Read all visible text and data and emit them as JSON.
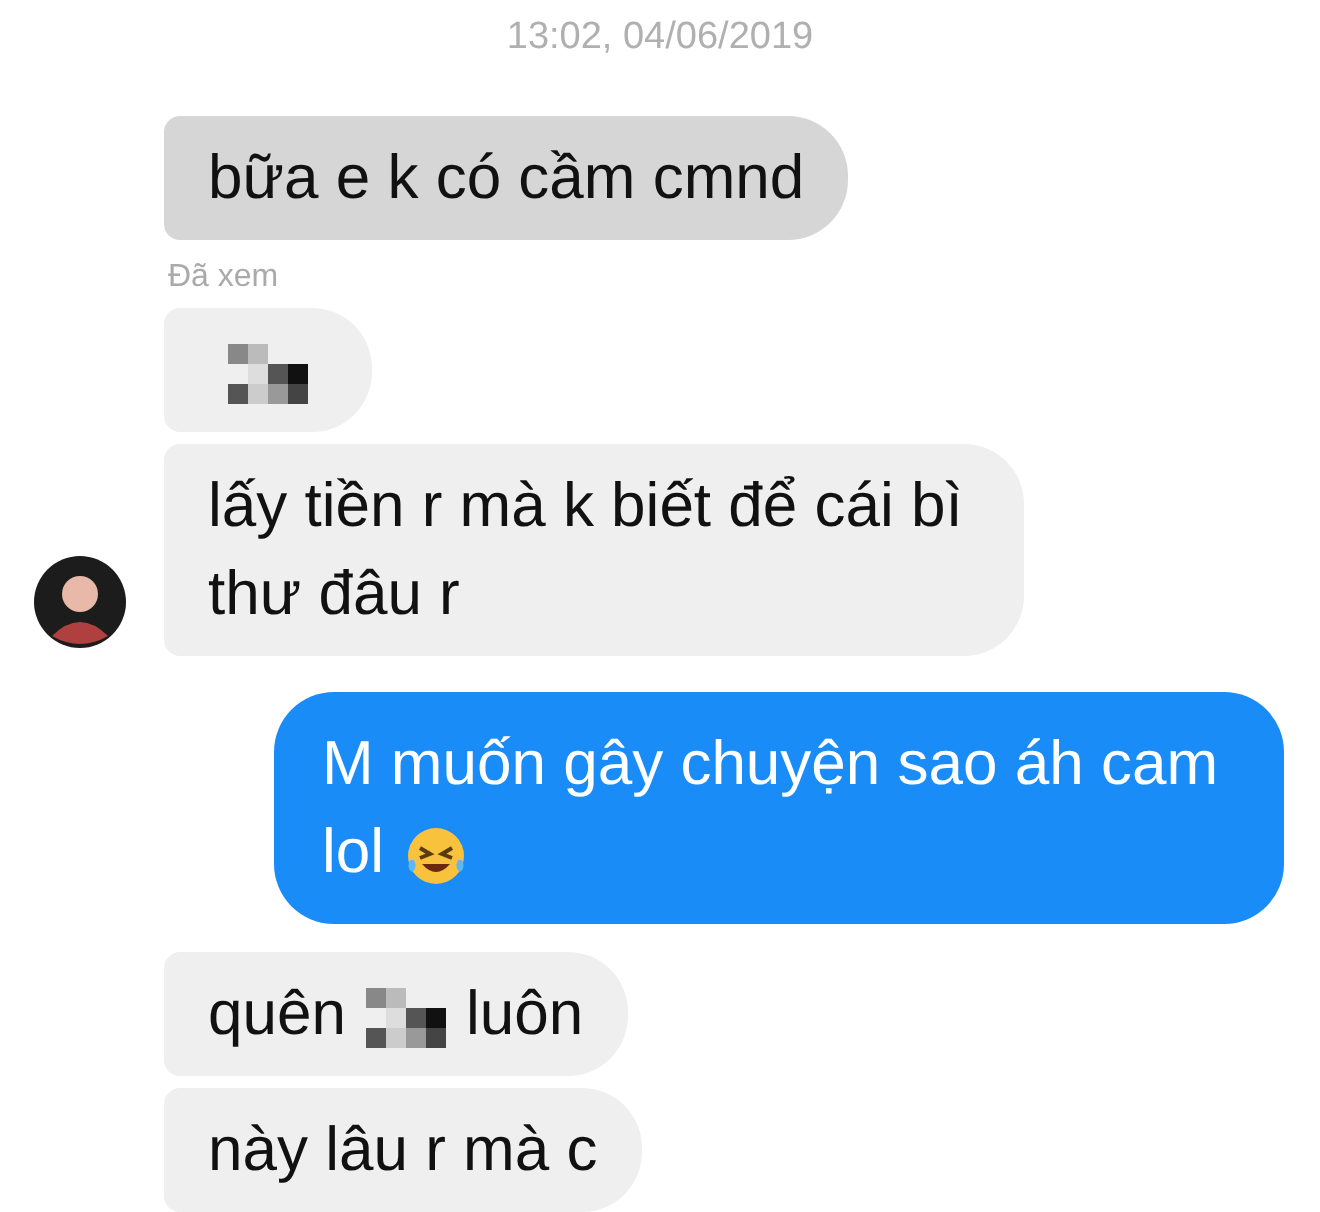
{
  "conversation": {
    "items": [
      {
        "kind": "timestamp",
        "text": "13:02, 04/06/2019"
      },
      {
        "kind": "received",
        "highlighted": true,
        "avatar": false,
        "parts": [
          {
            "kind": "text",
            "text": "bữa e k có cầm cmnd"
          }
        ]
      },
      {
        "kind": "seen",
        "text": "Đã xem"
      },
      {
        "kind": "received",
        "highlighted": false,
        "avatar": false,
        "parts": [
          {
            "kind": "censored"
          }
        ]
      },
      {
        "kind": "received",
        "highlighted": false,
        "avatar": true,
        "parts": [
          {
            "kind": "text",
            "text": "lấy tiền r mà k biết để cái bì thư đâu r"
          }
        ]
      },
      {
        "kind": "sent",
        "parts": [
          {
            "kind": "text",
            "text": "M muốn gây chuyện sao áh cam lol"
          },
          {
            "kind": "emoji"
          }
        ]
      },
      {
        "kind": "received",
        "highlighted": false,
        "avatar": false,
        "parts": [
          {
            "kind": "text",
            "text": "quên"
          },
          {
            "kind": "censored"
          },
          {
            "kind": "text",
            "text": "luôn"
          }
        ]
      },
      {
        "kind": "received",
        "highlighted": false,
        "avatar": false,
        "parts": [
          {
            "kind": "text",
            "text": "này lâu r mà c"
          }
        ]
      }
    ]
  }
}
